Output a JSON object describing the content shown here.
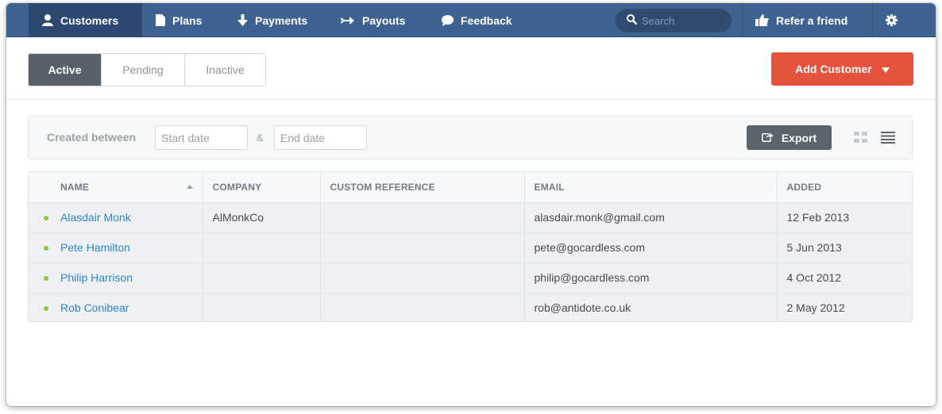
{
  "nav": {
    "items": [
      {
        "label": "Customers",
        "icon": "user-icon"
      },
      {
        "label": "Plans",
        "icon": "document-icon"
      },
      {
        "label": "Payments",
        "icon": "arrow-down-icon"
      },
      {
        "label": "Payouts",
        "icon": "arrow-right-icon"
      },
      {
        "label": "Feedback",
        "icon": "speech-bubble-icon"
      }
    ],
    "search_placeholder": "Search",
    "refer_label": "Refer a friend",
    "settings_icon": "gear-icon"
  },
  "tabs": [
    {
      "label": "Active",
      "active": true
    },
    {
      "label": "Pending",
      "active": false
    },
    {
      "label": "Inactive",
      "active": false
    }
  ],
  "add_customer_label": "Add Customer",
  "filter": {
    "label": "Created between",
    "start_placeholder": "Start date",
    "separator": "&",
    "end_placeholder": "End date",
    "export_label": "Export"
  },
  "table": {
    "columns": [
      "NAME",
      "COMPANY",
      "CUSTOM REFERENCE",
      "EMAIL",
      "ADDED"
    ],
    "rows": [
      {
        "name": "Alasdair Monk",
        "company": "AlMonkCo",
        "reference": "",
        "email": "alasdair.monk@gmail.com",
        "added": "12 Feb 2013"
      },
      {
        "name": "Pete Hamilton",
        "company": "",
        "reference": "",
        "email": "pete@gocardless.com",
        "added": "5 Jun 2013"
      },
      {
        "name": "Philip Harrison",
        "company": "",
        "reference": "",
        "email": "philip@gocardless.com",
        "added": "4 Oct 2012"
      },
      {
        "name": "Rob Conibear",
        "company": "",
        "reference": "",
        "email": "rob@antidote.co.uk",
        "added": "2 May 2012"
      }
    ]
  },
  "colors": {
    "nav_bg": "#3f6390",
    "accent": "#e5533d",
    "link": "#2e86c8",
    "status_active": "#8cc63e"
  }
}
